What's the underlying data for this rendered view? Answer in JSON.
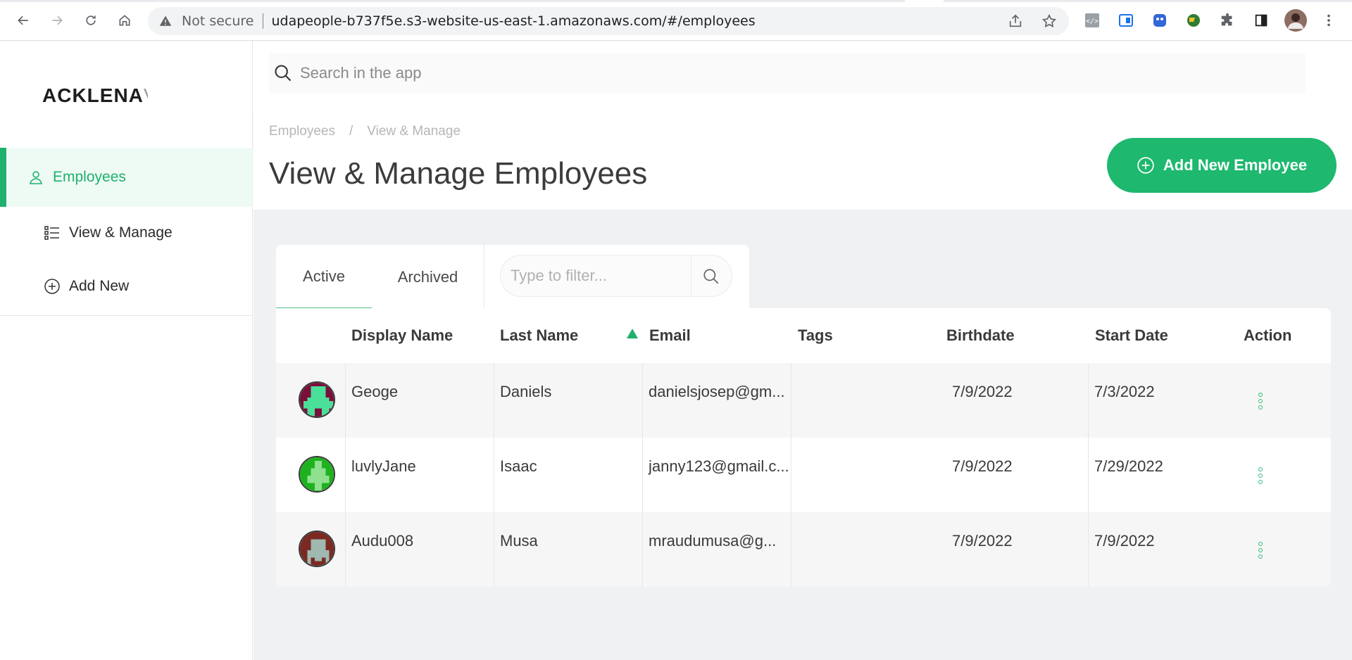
{
  "browser": {
    "security_label": "Not secure",
    "url": "udapeople-b737f5e.s3-website-us-east-1.amazonaws.com/#/employees"
  },
  "sidebar": {
    "logo_main": "ACKLENA",
    "logo_fade": "V",
    "items": [
      {
        "label": "Employees",
        "icon": "user-icon"
      },
      {
        "label": "View & Manage",
        "icon": "list-icon"
      },
      {
        "label": "Add New",
        "icon": "plus-circle-icon"
      }
    ]
  },
  "topbar": {
    "search_placeholder": "Search in the app"
  },
  "header": {
    "breadcrumb": [
      "Employees",
      "/",
      "View & Manage"
    ],
    "title": "View & Manage Employees",
    "add_button_label": "Add New Employee"
  },
  "tabs": {
    "items": [
      "Active",
      "Archived"
    ],
    "active": "Active",
    "filter_placeholder": "Type to filter..."
  },
  "table": {
    "columns": [
      "Display Name",
      "Last Name",
      "Email",
      "Tags",
      "Birthdate",
      "Start Date",
      "Action"
    ],
    "sorted_column": "Email",
    "sort_direction": "ascending",
    "rows": [
      {
        "display_name": "Geoge",
        "last_name": "Daniels",
        "email": "danielsjosep@gm...",
        "tags": "",
        "birthdate": "7/9/2022",
        "start_date": "7/3/2022",
        "avatar_bg": "#7a0f3a",
        "avatar_fg": "#4be09a"
      },
      {
        "display_name": "luvlyJane",
        "last_name": "Isaac",
        "email": "janny123@gmail.c...",
        "tags": "",
        "birthdate": "7/9/2022",
        "start_date": "7/29/2022",
        "avatar_bg": "#1fb21f",
        "avatar_fg": "#8fe08f"
      },
      {
        "display_name": "Audu008",
        "last_name": "Musa",
        "email": "mraudumusa@g...",
        "tags": "",
        "birthdate": "7/9/2022",
        "start_date": "7/9/2022",
        "avatar_bg": "#7a2a22",
        "avatar_fg": "#9fb8b0"
      }
    ]
  },
  "colors": {
    "accent": "#1eb16d",
    "button": "#1eb86f",
    "content_bg": "#eff1f2"
  }
}
